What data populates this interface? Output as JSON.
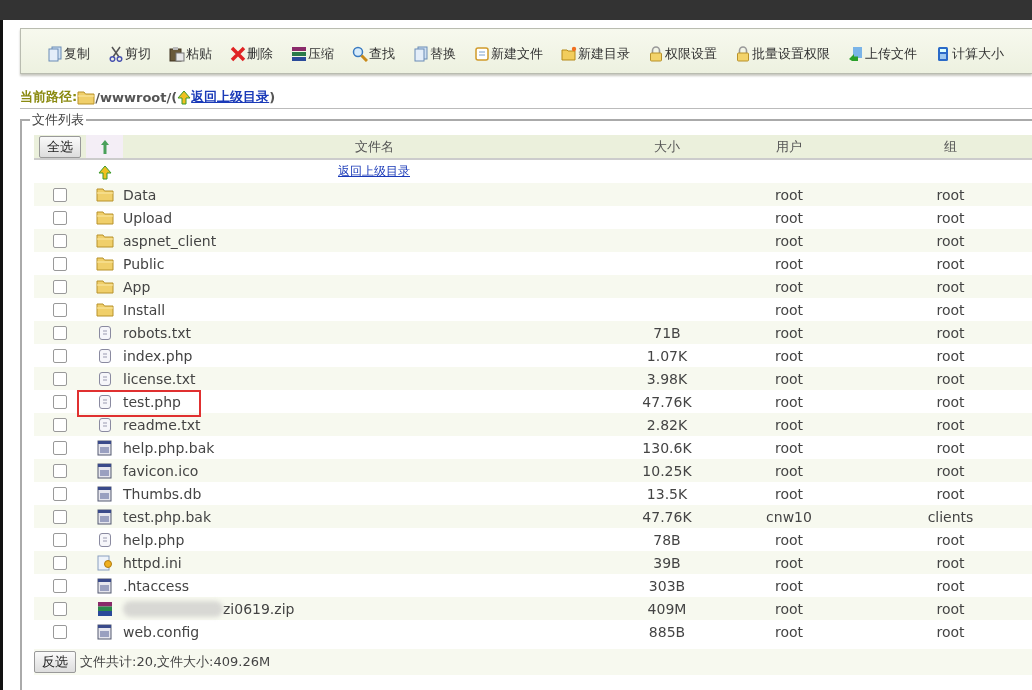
{
  "toolbar": [
    {
      "label": "复制"
    },
    {
      "label": "剪切"
    },
    {
      "label": "粘贴"
    },
    {
      "label": "删除"
    },
    {
      "label": "压缩"
    },
    {
      "label": "查找"
    },
    {
      "label": "替换"
    },
    {
      "label": "新建文件"
    },
    {
      "label": "新建目录"
    },
    {
      "label": "权限设置"
    },
    {
      "label": "批量设置权限"
    },
    {
      "label": "上传文件"
    },
    {
      "label": "计算大小"
    }
  ],
  "path": {
    "label": "当前路径:",
    "value": "/wwwroot/(",
    "link": "返回上级目录",
    "tail": ")"
  },
  "file_list": {
    "legend": "文件列表",
    "select_all": "全选",
    "invert": "反选",
    "columns": [
      "文件名",
      "大小",
      "用户",
      "组"
    ],
    "parent_link": "返回上级目录",
    "rows": [
      {
        "kind": "folder",
        "name": "Data",
        "user": "root",
        "group": "root",
        "checked": false,
        "highlighted": false
      },
      {
        "kind": "folder",
        "name": "Upload",
        "user": "root",
        "group": "root",
        "checked": false,
        "highlighted": false
      },
      {
        "kind": "folder",
        "name": "aspnet_client",
        "user": "root",
        "group": "root",
        "checked": false,
        "highlighted": false
      },
      {
        "kind": "folder",
        "name": "Public",
        "user": "root",
        "group": "root",
        "checked": false,
        "highlighted": false
      },
      {
        "kind": "folder",
        "name": "App",
        "user": "root",
        "group": "root",
        "checked": false,
        "highlighted": false
      },
      {
        "kind": "folder",
        "name": "Install",
        "user": "root",
        "group": "root",
        "checked": false,
        "highlighted": false
      },
      {
        "kind": "text",
        "name": "robots.txt",
        "size": "71B",
        "user": "root",
        "group": "root",
        "checked": false,
        "highlighted": false
      },
      {
        "kind": "text",
        "name": "index.php",
        "size": "1.07K",
        "user": "root",
        "group": "root",
        "checked": false,
        "highlighted": false
      },
      {
        "kind": "text",
        "name": "license.txt",
        "size": "3.98K",
        "user": "root",
        "group": "root",
        "checked": false,
        "highlighted": false
      },
      {
        "kind": "text",
        "name": "test.php",
        "size": "47.76K",
        "user": "root",
        "group": "root",
        "checked": false,
        "highlighted": true
      },
      {
        "kind": "text",
        "name": "readme.txt",
        "size": "2.82K",
        "user": "root",
        "group": "root",
        "checked": false,
        "highlighted": false
      },
      {
        "kind": "binary",
        "name": "help.php.bak",
        "size": "130.6K",
        "user": "root",
        "group": "root",
        "checked": false,
        "highlighted": false
      },
      {
        "kind": "binary",
        "name": "favicon.ico",
        "size": "10.25K",
        "user": "root",
        "group": "root",
        "checked": false,
        "highlighted": false
      },
      {
        "kind": "binary",
        "name": "Thumbs.db",
        "size": "13.5K",
        "user": "root",
        "group": "root",
        "checked": false,
        "highlighted": false
      },
      {
        "kind": "binary",
        "name": "test.php.bak",
        "size": "47.76K",
        "user": "cnw10",
        "group": "clients",
        "checked": false,
        "highlighted": false
      },
      {
        "kind": "text",
        "name": "help.php",
        "size": "78B",
        "user": "root",
        "group": "root",
        "checked": false,
        "highlighted": false
      },
      {
        "kind": "settings",
        "name": "httpd.ini",
        "size": "39B",
        "user": "root",
        "group": "root",
        "checked": false,
        "highlighted": false
      },
      {
        "kind": "binary",
        "name": ".htaccess",
        "size": "303B",
        "user": "root",
        "group": "root",
        "checked": false,
        "highlighted": false
      },
      {
        "kind": "archive",
        "name": "zi0619.zip",
        "redacted": true,
        "size": "409M",
        "user": "root",
        "group": "root",
        "checked": false,
        "highlighted": false
      },
      {
        "kind": "binary",
        "name": "web.config",
        "size": "885B",
        "user": "root",
        "group": "root",
        "checked": false,
        "highlighted": false
      }
    ],
    "summary": "文件共计:20,文件大小:409.26M"
  }
}
